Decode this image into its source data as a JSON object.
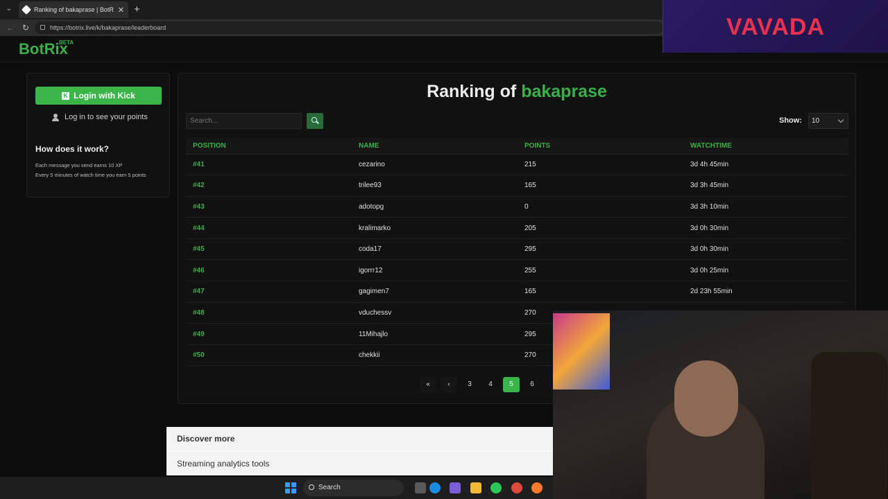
{
  "browser": {
    "tab_title": "Ranking of bakaprase | BotRix — (",
    "url": "https://botrix.live/k/bakaprase/leaderboard"
  },
  "ad": {
    "logo": "VAVADA"
  },
  "site": {
    "brand": "BotRix",
    "brand_badge": "BETA"
  },
  "sidebar": {
    "login_button": "Login with Kick",
    "login_hint": "Log in to see your points",
    "how_title": "How does it work?",
    "how_lines": [
      "Each message you send earns 10 XP",
      "Every 5 minutes of watch time you earn 5 points"
    ]
  },
  "leaderboard": {
    "title_prefix": "Ranking of",
    "channel": "bakaprase",
    "search_placeholder": "Search...",
    "show_label": "Show:",
    "show_value": "10",
    "columns": [
      "POSITION",
      "NAME",
      "POINTS",
      "WATCHTIME"
    ],
    "rows": [
      [
        "#41",
        "cezarino",
        "215",
        "3d 4h 45min"
      ],
      [
        "#42",
        "trilee93",
        "165",
        "3d 3h 45min"
      ],
      [
        "#43",
        "adotopg",
        "0",
        "3d 3h 10min"
      ],
      [
        "#44",
        "kralimarko",
        "205",
        "3d 0h 30min"
      ],
      [
        "#45",
        "coda17",
        "295",
        "3d 0h 30min"
      ],
      [
        "#46",
        "igorrr12",
        "255",
        "3d 0h 25min"
      ],
      [
        "#47",
        "gagimen7",
        "165",
        "2d 23h 55min"
      ],
      [
        "#48",
        "vduchessv",
        "270",
        ""
      ],
      [
        "#49",
        "11Mihajlo",
        "295",
        ""
      ],
      [
        "#50",
        "chekkii",
        "270",
        ""
      ]
    ],
    "pagination": {
      "first_icon": "double-chevron-left-icon",
      "prev_icon": "circle-chevron-left-icon",
      "pages": [
        "3",
        "4",
        "5",
        "6"
      ],
      "active_page": "5"
    }
  },
  "discover": {
    "title": "Discover more",
    "item": "Streaming analytics tools"
  },
  "taskbar": {
    "search_label": "Search"
  },
  "colors": {
    "accent": "#3bb04a",
    "background": "#0c0c0c",
    "panel": "#111111"
  }
}
